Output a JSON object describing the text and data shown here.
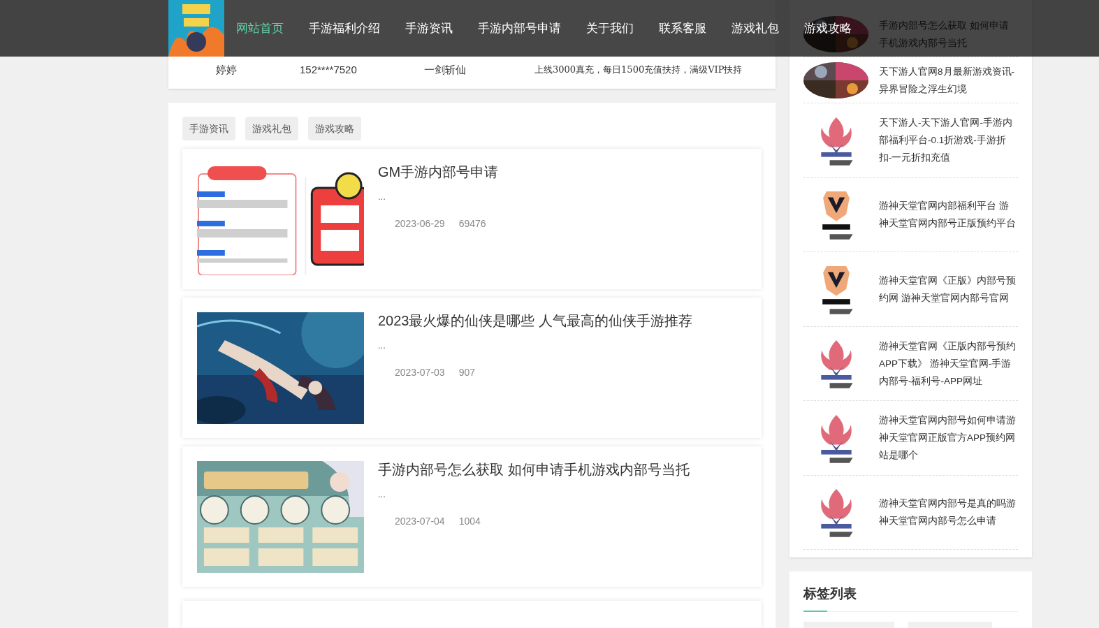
{
  "nav": {
    "items": [
      {
        "label": "网站首页",
        "selected": true
      },
      {
        "label": "手游福利介绍",
        "selected": false
      },
      {
        "label": "手游资讯",
        "selected": false
      },
      {
        "label": "手游内部号申请",
        "selected": false
      },
      {
        "label": "关于我们",
        "selected": false
      },
      {
        "label": "联系客服",
        "selected": false
      },
      {
        "label": "游戏礼包",
        "selected": false
      },
      {
        "label": "游戏攻略",
        "selected": false
      }
    ]
  },
  "table": {
    "rows": [
      {
        "column_1": "婷婷",
        "column_2": "152****7520",
        "column_3": "一剑斩仙",
        "column_4": "上线3000真充，每日1500充值扶持，满级VIP扶持"
      }
    ]
  },
  "tabs": [
    "手游资讯",
    "游戏礼包",
    "游戏攻略"
  ],
  "articles": [
    {
      "title": "GM手游内部号申请",
      "excerpt": "...",
      "date": "2023-06-29",
      "views": "69476",
      "kind": "poster"
    },
    {
      "title": "2023最火爆的仙侠是哪些 人气最高的仙侠手游推荐",
      "excerpt": "...",
      "date": "2023-07-03",
      "views": "907",
      "kind": "underwater"
    },
    {
      "title": "手游内部号怎么获取 如何申请手机游戏内部号当托",
      "excerpt": "...",
      "date": "2023-07-04",
      "views": "1004",
      "kind": "banner"
    }
  ],
  "sidebar": {
    "items": [
      {
        "title": "手游内部号怎么获取 如何申请手机游戏内部号当托"
      },
      {
        "title": "天下游人官网8月最新游戏资讯-异界冒险之浮生幻境"
      },
      {
        "title": "天下游人-天下游人官网-手游内部福利平台-0.1折游戏-手游折扣-一元折扣充值",
        "kind": "flame"
      },
      {
        "title": "游神天堂官网内部福利平台 游神天堂官网内部号正版预约平台",
        "kind": "shield"
      },
      {
        "title": "游神天堂官网《正版》内部号预约网 游神天堂官网内部号官网",
        "kind": "shield"
      },
      {
        "title": "游神天堂官网《正版内部号预约APP下载》 游神天堂官网-手游内部号-福利号-APP网址",
        "kind": "flame"
      },
      {
        "title": "游神天堂官网内部号如何申请游神天堂官网正版官方APP预约网站是哪个",
        "kind": "flame"
      },
      {
        "title": "游神天堂官网内部号是真的吗游神天堂官网内部号怎么申请",
        "kind": "flame"
      }
    ],
    "tags_title": "标签列表"
  }
}
